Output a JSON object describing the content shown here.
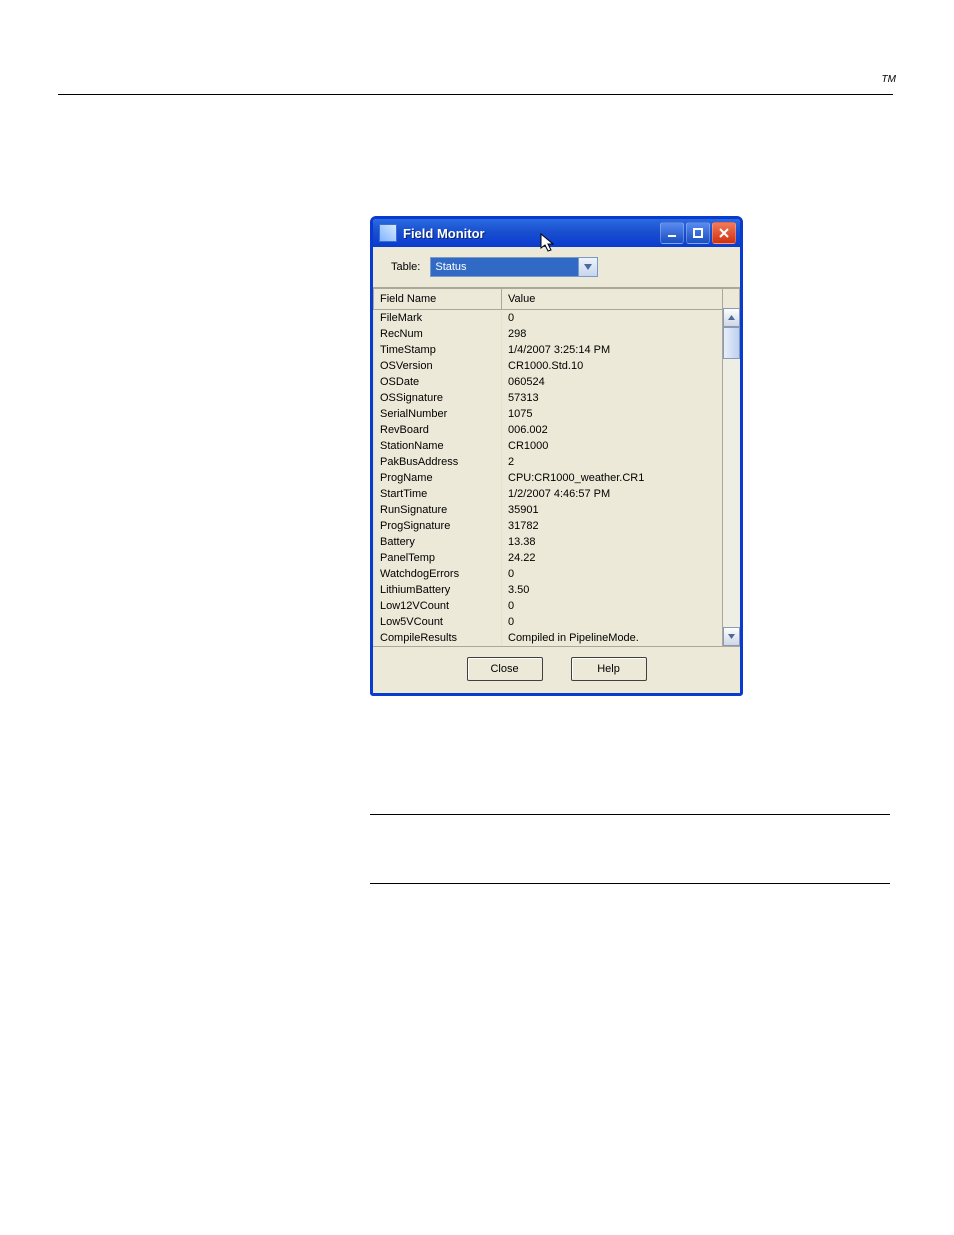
{
  "header": {
    "tm": "TM"
  },
  "window": {
    "title": "Field Monitor",
    "table_label": "Table:",
    "table_selected": "Status",
    "columns": {
      "field_name": "Field Name",
      "value": "Value"
    },
    "rows": [
      {
        "name": "FileMark",
        "value": "0"
      },
      {
        "name": "RecNum",
        "value": "298"
      },
      {
        "name": "TimeStamp",
        "value": "1/4/2007 3:25:14 PM"
      },
      {
        "name": "OSVersion",
        "value": "CR1000.Std.10"
      },
      {
        "name": "OSDate",
        "value": "060524"
      },
      {
        "name": "OSSignature",
        "value": "57313"
      },
      {
        "name": "SerialNumber",
        "value": "1075"
      },
      {
        "name": "RevBoard",
        "value": "006.002"
      },
      {
        "name": "StationName",
        "value": "CR1000"
      },
      {
        "name": "PakBusAddress",
        "value": "2"
      },
      {
        "name": "ProgName",
        "value": "CPU:CR1000_weather.CR1"
      },
      {
        "name": "StartTime",
        "value": "1/2/2007 4:46:57 PM"
      },
      {
        "name": "RunSignature",
        "value": "35901"
      },
      {
        "name": "ProgSignature",
        "value": "31782"
      },
      {
        "name": "Battery",
        "value": "13.38"
      },
      {
        "name": "PanelTemp",
        "value": "24.22"
      },
      {
        "name": "WatchdogErrors",
        "value": "0"
      },
      {
        "name": "LithiumBattery",
        "value": "3.50"
      },
      {
        "name": "Low12VCount",
        "value": "0"
      },
      {
        "name": "Low5VCount",
        "value": "0"
      },
      {
        "name": "CompileResults",
        "value": "Compiled in PipelineMode."
      }
    ],
    "buttons": {
      "close": "Close",
      "help": "Help"
    }
  }
}
